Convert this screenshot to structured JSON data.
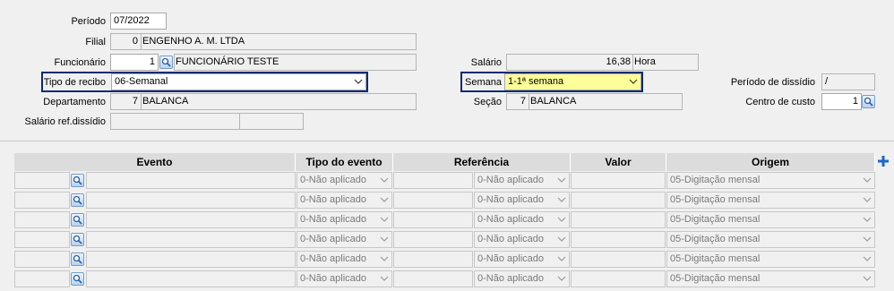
{
  "labels": {
    "periodo": "Período",
    "filial": "Filial",
    "funcionario": "Funcionário",
    "tipo_recibo": "Tipo de recibo",
    "departamento": "Departamento",
    "salario_ref": "Salário ref.dissídio",
    "salario": "Salário",
    "semana": "Semana",
    "secao": "Seção",
    "periodo_dissidio": "Período de dissídio",
    "centro_custo": "Centro de custo"
  },
  "values": {
    "periodo": "07/2022",
    "filial_code": "0",
    "filial_name": "ENGENHO A. M. LTDA",
    "funcionario_code": "1",
    "funcionario_name": "FUNCIONÁRIO TESTE",
    "tipo_recibo": "06-Semanal",
    "departamento_code": "7",
    "departamento_name": "BALANCA",
    "salario_value": "16,38",
    "salario_unit": "Hora",
    "semana": "1-1ª semana",
    "secao_code": "7",
    "secao_name": "BALANCA",
    "periodo_dissidio": "/",
    "centro_custo": "1"
  },
  "colors": {
    "highlight_border": "#0b2a6f",
    "semana_bg": "#ffff99",
    "header_bg": "#dcdcdc"
  },
  "grid": {
    "headers": {
      "evento": "Evento",
      "tipo_evento": "Tipo do evento",
      "referencia": "Referência",
      "valor": "Valor",
      "origem": "Origem"
    },
    "rows": [
      {
        "tipo": "0-Não aplicado",
        "ref": "0-Não aplicado",
        "origem": "05-Digitação mensal"
      },
      {
        "tipo": "0-Não aplicado",
        "ref": "0-Não aplicado",
        "origem": "05-Digitação mensal"
      },
      {
        "tipo": "0-Não aplicado",
        "ref": "0-Não aplicado",
        "origem": "05-Digitação mensal"
      },
      {
        "tipo": "0-Não aplicado",
        "ref": "0-Não aplicado",
        "origem": "05-Digitação mensal"
      },
      {
        "tipo": "0-Não aplicado",
        "ref": "0-Não aplicado",
        "origem": "05-Digitação mensal"
      },
      {
        "tipo": "0-Não aplicado",
        "ref": "0-Não aplicado",
        "origem": "05-Digitação mensal"
      }
    ]
  }
}
